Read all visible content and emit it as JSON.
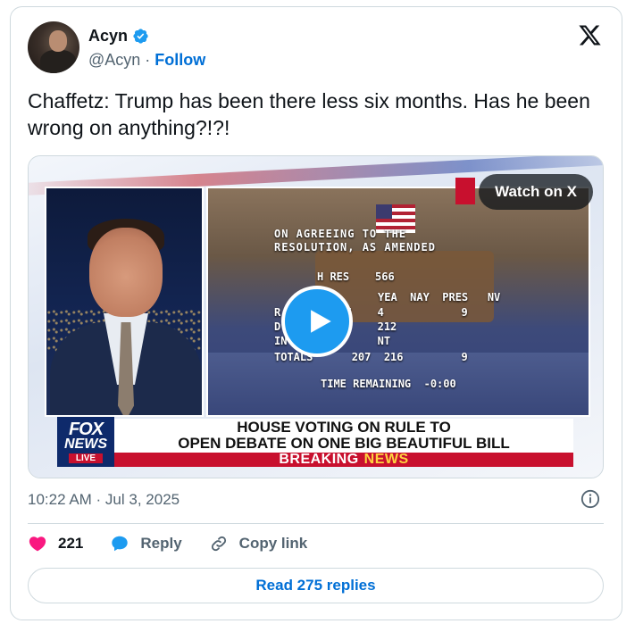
{
  "author": {
    "name": "Acyn",
    "handle": "@Acyn",
    "separator": "·",
    "follow_label": "Follow"
  },
  "tweet": {
    "text": "Chaffetz: Trump has been there less six months. Has he been wrong on anything?!?!",
    "timestamp": "10:22 AM · Jul 3, 2025"
  },
  "media": {
    "watch_label": "Watch on X",
    "board": {
      "line1": "ON AGREEING TO THE",
      "line2": "RESOLUTION, AS AMENDED",
      "res": "H RES    566",
      "header": "YEA  NAY  PRES   NV",
      "row_r": "R        207    4            9",
      "row_d": "D               212",
      "row_i": "IN              NT",
      "totals": "TOTALS      207  216         9",
      "time": "TIME REMAINING  -0:00"
    },
    "logo": {
      "line1": "FOX",
      "line2": "NEWS",
      "line3": "LIVE"
    },
    "headline_line1": "HOUSE VOTING ON RULE TO",
    "headline_line2": "OPEN DEBATE ON ONE BIG BEAUTIFUL BILL",
    "breaking": "BREAKING",
    "breaking_news": "NEWS"
  },
  "actions": {
    "likes": "221",
    "reply_label": "Reply",
    "copy_label": "Copy link"
  },
  "replies_button": "Read 275 replies",
  "colors": {
    "accent": "#006fd6",
    "like": "#f91880",
    "verified": "#1d9bf0",
    "fox_red": "#c8102e"
  }
}
